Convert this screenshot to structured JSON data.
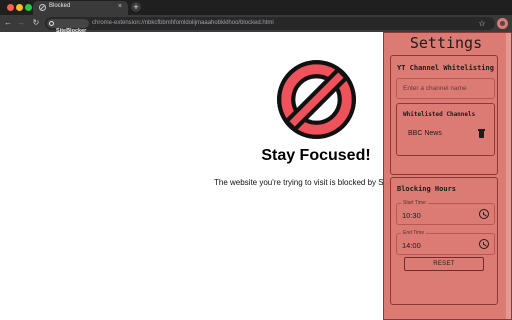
{
  "browser": {
    "tab_title": "Blocked",
    "tab_close": "×",
    "new_tab": "+",
    "site_chip": "SiteBlocker",
    "url": "chrome-extension://nbkcfbbmhfomldolijmaaahobkklhoo/blocked.html",
    "nav_back": "←",
    "nav_forward": "→",
    "nav_reload": "↻",
    "bookmark": "☆"
  },
  "page": {
    "title": "Stay Focused!",
    "message": "The website you're trying to visit is blocked by S",
    "icon": "prohibited-icon",
    "icon_colors": {
      "fill": "#f0525c",
      "stroke": "#111111"
    }
  },
  "popup": {
    "title": "Settings",
    "accent": "#dc7b73",
    "yt_section": {
      "heading": "YT Channel Whitelisting",
      "input_placeholder": "Enter a channel name",
      "whitelist": {
        "heading": "Whitelisted Channels",
        "channels": [
          {
            "name": "BBC News",
            "action_icon": "trash-icon"
          }
        ]
      }
    },
    "hours_section": {
      "heading": "Blocking Hours",
      "start": {
        "label": "Start Time",
        "value": "10:30",
        "icon": "clock-icon"
      },
      "end": {
        "label": "End Time",
        "value": "14:00",
        "icon": "clock-icon"
      },
      "reset_label": "RESET"
    }
  }
}
